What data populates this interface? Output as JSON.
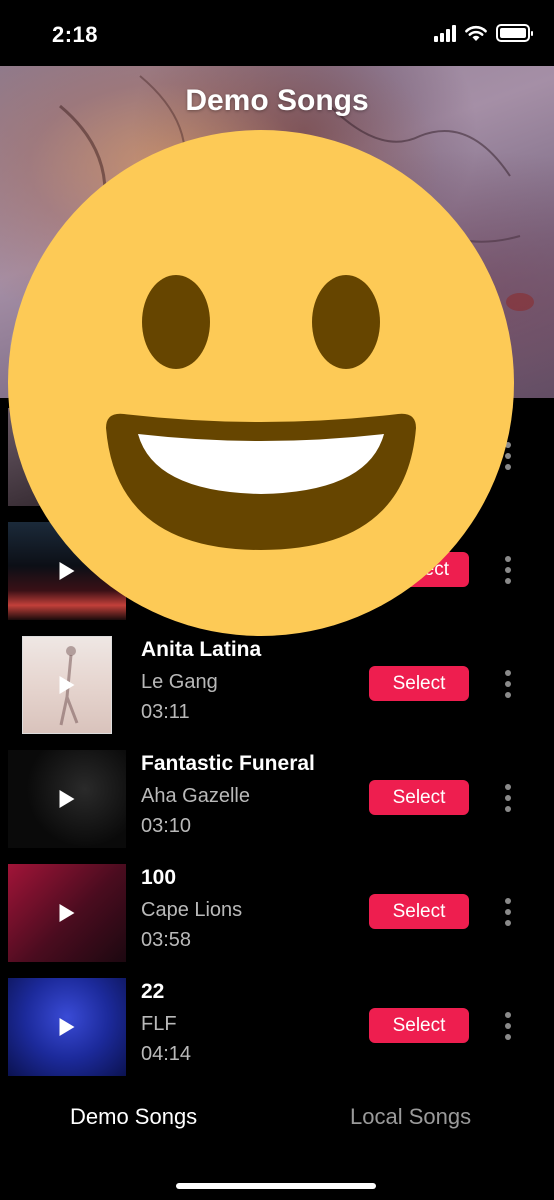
{
  "status_bar": {
    "time": "2:18"
  },
  "header": {
    "title": "Demo Songs"
  },
  "songs": [
    {
      "title": "",
      "artist": "",
      "duration": "",
      "select_label": ""
    },
    {
      "title": "",
      "artist": "",
      "duration": "",
      "select_label": "lect"
    },
    {
      "title": "Anita Latina",
      "artist": "Le Gang",
      "duration": "03:11",
      "select_label": "Select"
    },
    {
      "title": "Fantastic Funeral",
      "artist": "Aha Gazelle",
      "duration": "03:10",
      "select_label": "Select"
    },
    {
      "title": "100",
      "artist": "Cape Lions",
      "duration": "03:58",
      "select_label": "Select"
    },
    {
      "title": "22",
      "artist": "FLF",
      "duration": "04:14",
      "select_label": "Select"
    }
  ],
  "tabs": {
    "demo": "Demo Songs",
    "local": "Local Songs"
  },
  "colors": {
    "accent": "#ee1e4f",
    "background": "#000000",
    "emoji_face": "#fdca56",
    "emoji_features": "#664500"
  },
  "icons": {
    "overlay": "grinning-face-emoji",
    "play": "play-icon",
    "more": "more-vertical-icon"
  }
}
